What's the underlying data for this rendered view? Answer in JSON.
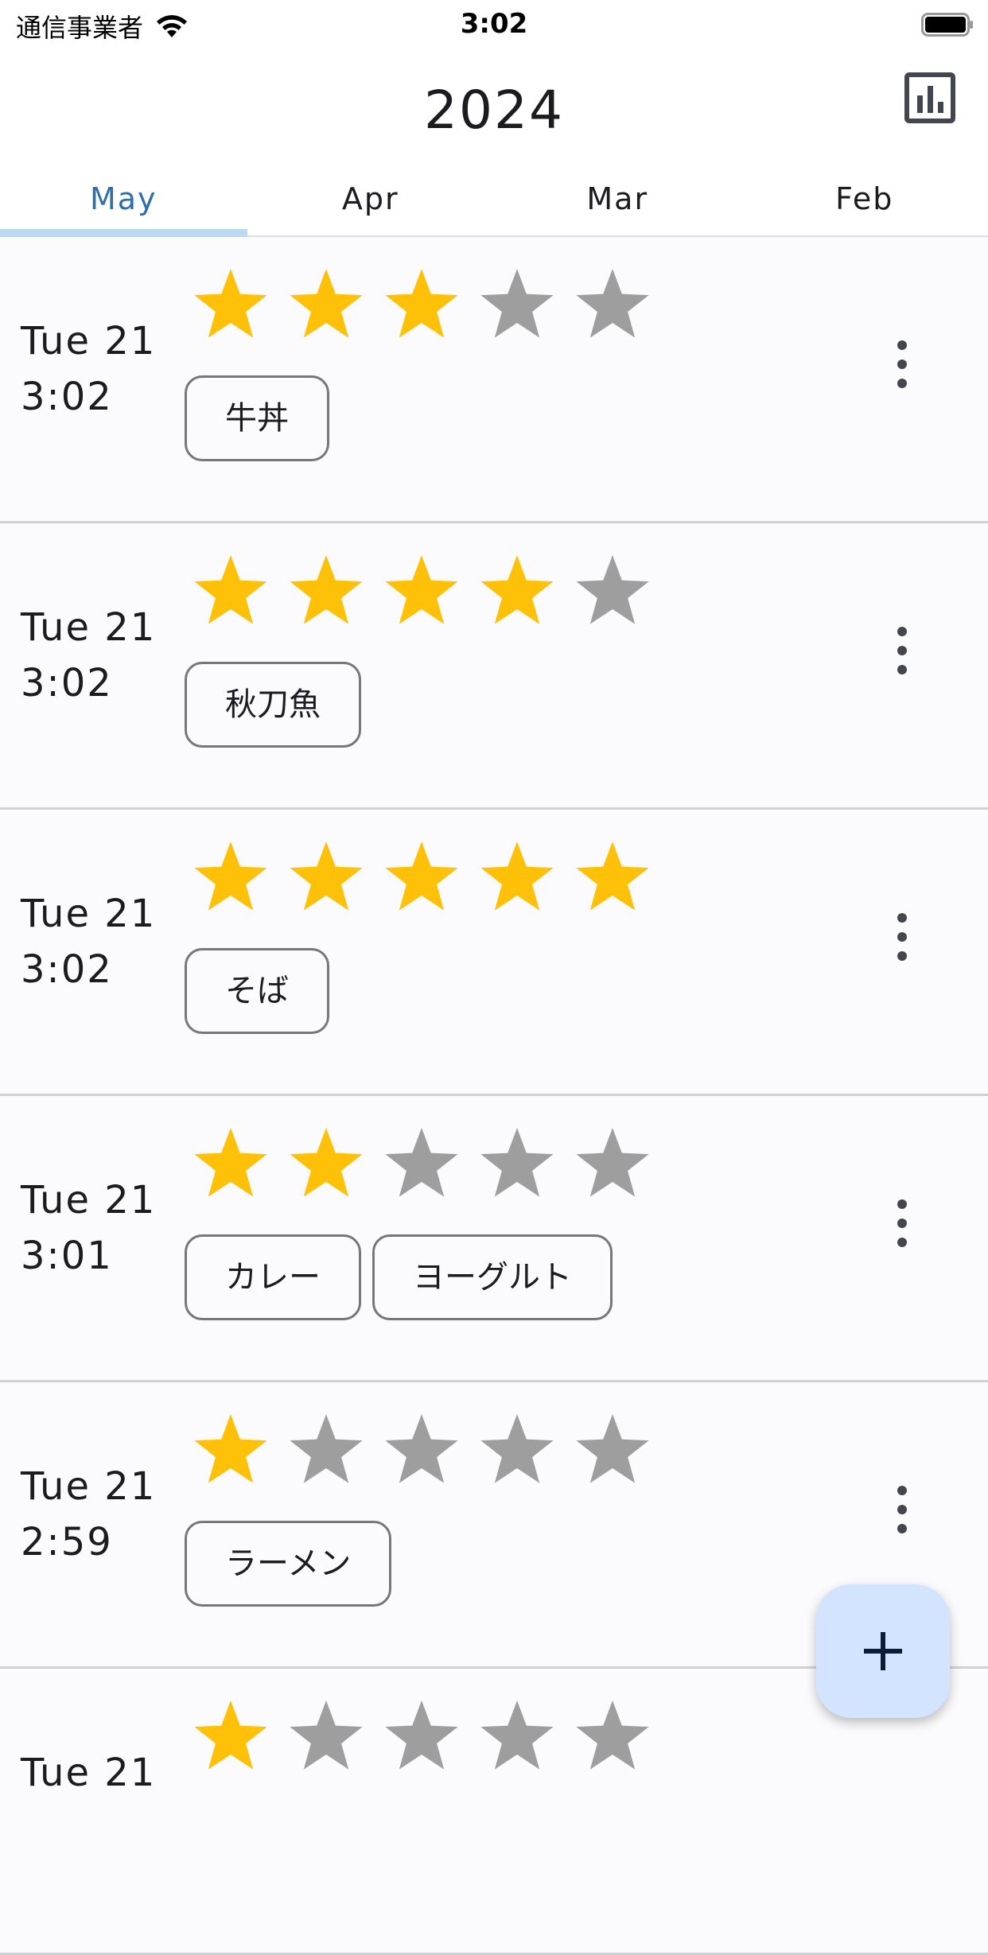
{
  "status_bar": {
    "carrier": "通信事業者",
    "time": "3:02"
  },
  "app_bar": {
    "title": "2024",
    "stats_icon": "bar-chart-icon"
  },
  "tabs": [
    {
      "label": "May",
      "active": true
    },
    {
      "label": "Apr",
      "active": false
    },
    {
      "label": "Mar",
      "active": false
    },
    {
      "label": "Feb",
      "active": false
    }
  ],
  "entries": [
    {
      "day": "Tue 21",
      "time": "3:02",
      "rating": 3,
      "max_rating": 5,
      "tags": [
        "牛丼"
      ]
    },
    {
      "day": "Tue 21",
      "time": "3:02",
      "rating": 4,
      "max_rating": 5,
      "tags": [
        "秋刀魚"
      ]
    },
    {
      "day": "Tue 21",
      "time": "3:02",
      "rating": 5,
      "max_rating": 5,
      "tags": [
        "そば"
      ]
    },
    {
      "day": "Tue 21",
      "time": "3:01",
      "rating": 2,
      "max_rating": 5,
      "tags": [
        "カレー",
        "ヨーグルト"
      ]
    },
    {
      "day": "Tue 21",
      "time": "2:59",
      "rating": 1,
      "max_rating": 5,
      "tags": [
        "ラーメン"
      ]
    },
    {
      "day": "Tue 21",
      "time": "",
      "rating": 1,
      "max_rating": 5,
      "tags": []
    }
  ],
  "colors": {
    "star_filled": "#ffc107",
    "star_empty": "#9e9e9e",
    "accent": "#2f6fa8",
    "fab_bg": "#d2e4ff"
  },
  "fab": {
    "icon": "plus-icon"
  }
}
